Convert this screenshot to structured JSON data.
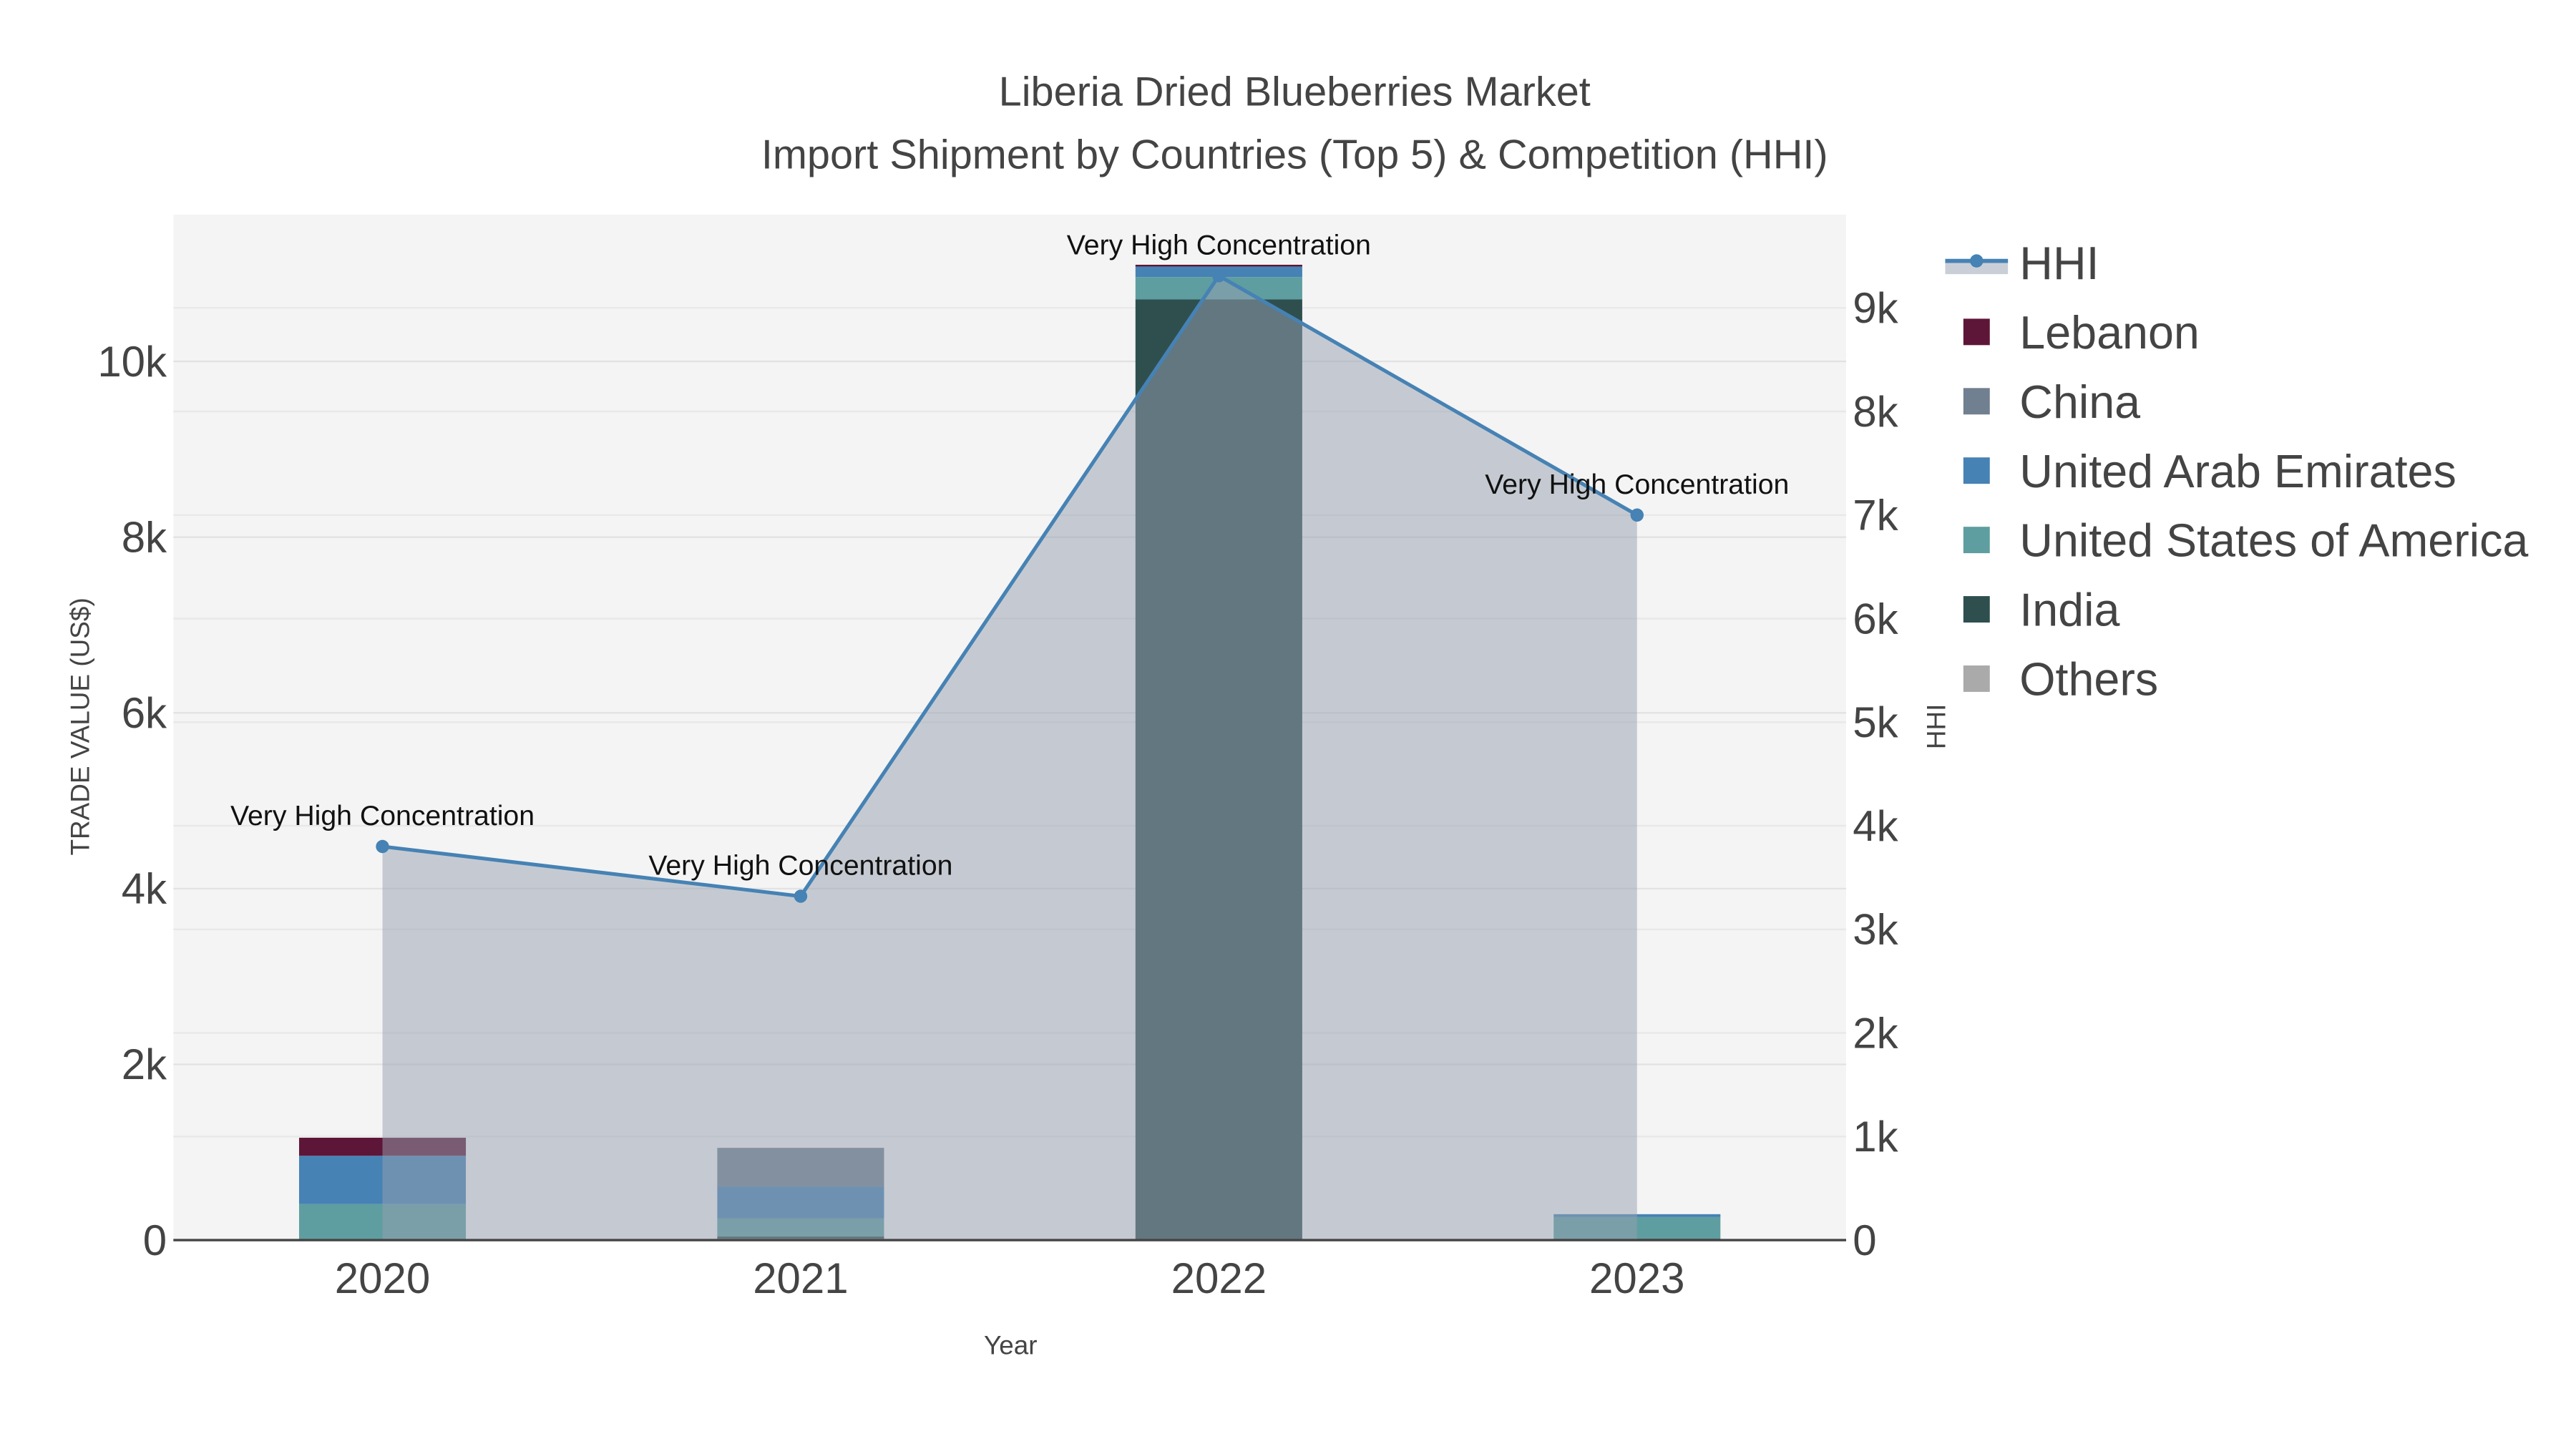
{
  "chart_data": {
    "type": "bar",
    "title_line1": "Liberia Dried Blueberries Market",
    "title_line2": "Import Shipment by Countries (Top 5) & Competition (HHI)",
    "xlabel": "Year",
    "ylabel": "TRADE VALUE (US$)",
    "y2label": "HHI",
    "categories": [
      "2020",
      "2021",
      "2022",
      "2023"
    ],
    "ylim": [
      0,
      11670
    ],
    "y2lim": [
      0,
      9900
    ],
    "yticks": [
      0,
      2000,
      4000,
      6000,
      8000,
      10000
    ],
    "ytick_labels": [
      "0",
      "2k",
      "4k",
      "6k",
      "8k",
      "10k"
    ],
    "y2ticks": [
      0,
      1000,
      2000,
      3000,
      4000,
      5000,
      6000,
      7000,
      8000,
      9000
    ],
    "y2tick_labels": [
      "0",
      "1k",
      "2k",
      "3k",
      "4k",
      "5k",
      "6k",
      "7k",
      "8k",
      "9k"
    ],
    "series": [
      {
        "name": "Others",
        "color": "#aaaaaa",
        "values": [
          0,
          16,
          0,
          0
        ]
      },
      {
        "name": "India",
        "color": "#2f4f4f",
        "values": [
          0,
          25,
          10705,
          16
        ]
      },
      {
        "name": "United States of America",
        "color": "#5f9ea0",
        "values": [
          410,
          205,
          255,
          246
        ]
      },
      {
        "name": "United Arab Emirates",
        "color": "#4682b4",
        "values": [
          550,
          361,
          120,
          33
        ]
      },
      {
        "name": "China",
        "color": "#708090",
        "values": [
          0,
          443,
          0,
          0
        ]
      },
      {
        "name": "Lebanon",
        "color": "#5e1638",
        "values": [
          205,
          0,
          20,
          0
        ]
      }
    ],
    "hhi": {
      "name": "HHI",
      "color": "#4682b4",
      "values": [
        3800,
        3320,
        9310,
        7000
      ],
      "annotations": [
        "Very High Concentration",
        "Very High Concentration",
        "Very High Concentration",
        "Very High Concentration"
      ]
    },
    "legend_order": [
      "HHI",
      "Lebanon",
      "China",
      "United Arab Emirates",
      "United States of America",
      "India",
      "Others"
    ],
    "legend_position": "right",
    "grid": true
  }
}
